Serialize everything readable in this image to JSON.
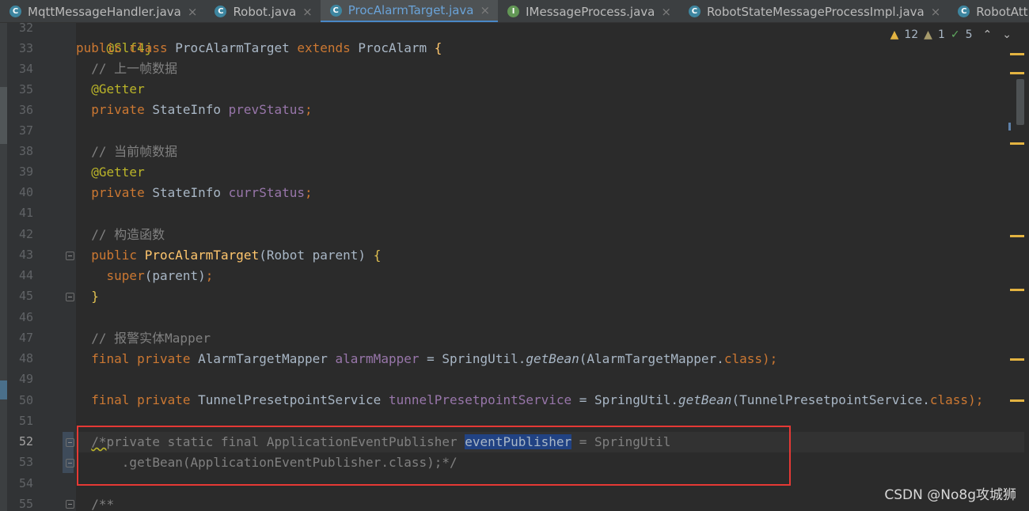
{
  "tabs": [
    {
      "label": "MqttMessageHandler.java",
      "icon": "class-icon",
      "icon_letter": "C",
      "close": "×"
    },
    {
      "label": "Robot.java",
      "icon": "class-icon",
      "icon_letter": "C",
      "close": "×"
    },
    {
      "label": "ProcAlarmTarget.java",
      "icon": "class-icon",
      "icon_letter": "C",
      "close": "×",
      "active": true
    },
    {
      "label": "IMessageProcess.java",
      "icon": "interface-icon",
      "icon_letter": "I",
      "close": "×"
    },
    {
      "label": "RobotStateMessageProcessImpl.java",
      "icon": "class-icon",
      "icon_letter": "C",
      "close": "×"
    },
    {
      "label": "RobotAttitud",
      "icon": "class-icon",
      "icon_letter": "C",
      "close": ""
    }
  ],
  "inspections": {
    "warnings": "12",
    "weak_warnings": "1",
    "ok": "5",
    "warn_glyph": "▲",
    "ok_glyph": "✓",
    "up": "⌃",
    "down": "⌄"
  },
  "line_numbers": [
    "32",
    "33",
    "34",
    "35",
    "36",
    "37",
    "38",
    "39",
    "40",
    "41",
    "42",
    "43",
    "44",
    "45",
    "46",
    "47",
    "48",
    "49",
    "50",
    "51",
    "52",
    "53",
    "54",
    "55"
  ],
  "current_line": "52",
  "code": {
    "l32": "@Slf4j",
    "l33_kw": "public class ",
    "l33_name": "ProcAlarmTarget ",
    "l33_ext": "extends ",
    "l33_super": "ProcAlarm ",
    "l33_brace": "{",
    "l34": "  // 上一帧数据",
    "l35": "  @Getter",
    "l36_kw": "  private ",
    "l36_type": "StateInfo ",
    "l36_field": "prevStatus",
    "l36_end": ";",
    "l38": "  // 当前帧数据",
    "l39": "  @Getter",
    "l40_kw": "  private ",
    "l40_type": "StateInfo ",
    "l40_field": "currStatus",
    "l40_end": ";",
    "l42": "  // 构造函数",
    "l43_kw": "  public ",
    "l43_name": "ProcAlarmTarget",
    "l43_rest": "(Robot parent) ",
    "l43_brace": "{",
    "l44_kw": "    super",
    "l44_rest": "(parent)",
    "l44_end": ";",
    "l45": "  }",
    "l47": "  // 报警实体Mapper",
    "l48_kw": "  final private ",
    "l48_type": "AlarmTargetMapper ",
    "l48_field": "alarmMapper",
    "l48_eq": " = SpringUtil.",
    "l48_call": "getBean",
    "l48_arg": "(AlarmTargetMapper.",
    "l48_cls": "class",
    "l48_end": ");",
    "l50_kw": "  final private ",
    "l50_type": "TunnelPresetpointService ",
    "l50_field": "tunnelPresetpointService",
    "l50_eq": " = SpringUtil.",
    "l50_call": "getBean",
    "l50_arg": "(TunnelPresetpointService.",
    "l50_cls": "class",
    "l50_end": ");",
    "l52_a": "/*",
    "l52_b": "private static final ApplicationEventPublisher ",
    "l52_sel": "eventPublisher",
    "l52_c": " = SpringUtil",
    "l53": "      .getBean(ApplicationEventPublisher.class);*/",
    "l55": "  /**"
  },
  "watermark": "CSDN @No8g攻城狮"
}
